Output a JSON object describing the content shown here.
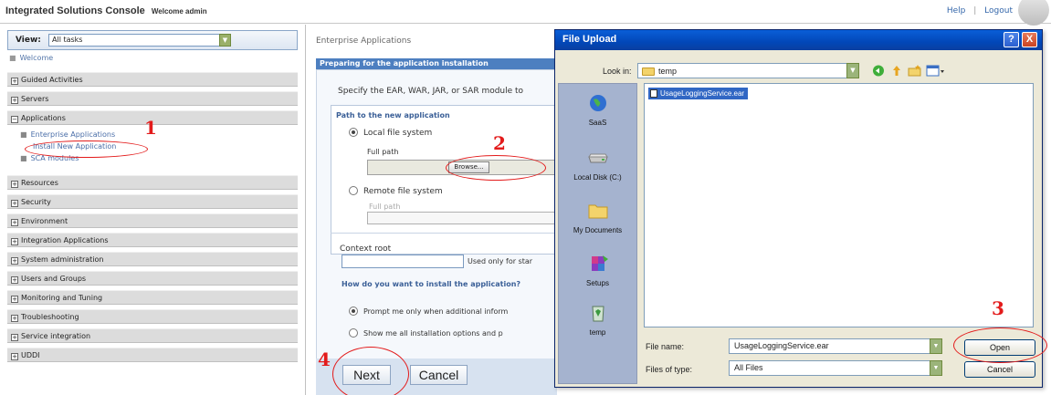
{
  "header": {
    "title": "Integrated Solutions Console",
    "welcome": "Welcome admin",
    "help": "Help",
    "separator": "|",
    "logout": "Logout"
  },
  "nav": {
    "view_label": "View:",
    "view_value": "All tasks",
    "welcome_link": "Welcome",
    "categories": {
      "guided": "Guided Activities",
      "servers": "Servers",
      "applications": "Applications",
      "resources": "Resources",
      "security": "Security",
      "environment": "Environment",
      "integration": "Integration Applications",
      "sysadmin": "System administration",
      "users": "Users and Groups",
      "monitoring": "Monitoring and Tuning",
      "troubleshooting": "Troubleshooting",
      "service_integration": "Service integration",
      "uddi": "UDDI"
    },
    "app_items": {
      "enterprise": "Enterprise Applications",
      "install": "Install New Application",
      "sca": "SCA modules"
    },
    "expand_symbol": "+",
    "collapse_symbol": "−"
  },
  "content": {
    "breadcrumb": "Enterprise Applications",
    "panel_title": "Preparing for the application installation",
    "specify_text": "Specify the EAR, WAR, JAR, or SAR module to",
    "path_section_title": "Path to the new application",
    "local_label": "Local file system",
    "full_path_label": "Full path",
    "browse_label": "Browse...",
    "remote_label": "Remote file system",
    "remote_full_path_label": "Full path",
    "context_root_label": "Context root",
    "used_only_text": "Used only for star",
    "how_title": "How do you want to install the application?",
    "prompt_option": "Prompt me only when additional inform",
    "show_option": "Show me all installation options and p",
    "next_label": "Next",
    "cancel_label": "Cancel"
  },
  "dialog": {
    "title": "File Upload",
    "help_glyph": "?",
    "close_glyph": "X",
    "look_in_label": "Look in:",
    "look_in_value": "temp",
    "places": [
      "SaaS",
      "Local Disk (C:)",
      "My Documents",
      "Setups",
      "temp"
    ],
    "files": [
      "UsageLoggingService.ear"
    ],
    "file_name_label": "File name:",
    "file_name_value": "UsageLoggingService.ear",
    "file_type_label": "Files of type:",
    "file_type_value": "All Files",
    "open_label": "Open",
    "cancel_label": "Cancel",
    "dropdown_glyph": "▼"
  },
  "annotations": [
    "1",
    "2",
    "3",
    "4"
  ],
  "colors": {
    "annotation_red": "#e31b1b",
    "title_bar_blue": "#0247b8",
    "panel_header_blue": "#4d7fc0",
    "selection_blue": "#3167c4"
  }
}
